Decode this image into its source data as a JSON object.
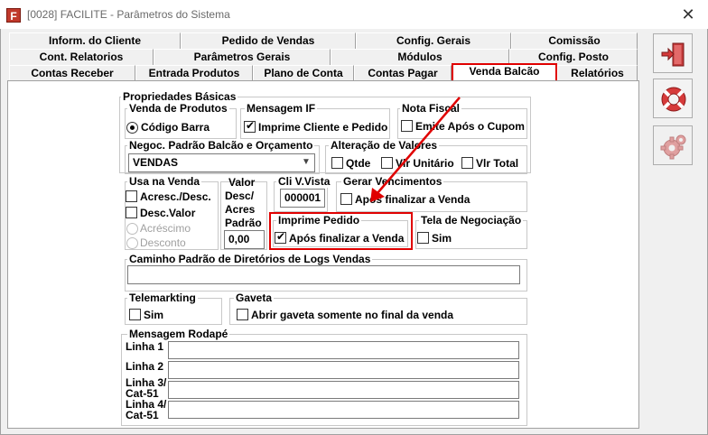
{
  "window": {
    "title": "[0028] FACILITE - Parâmetros do Sistema",
    "app_icon_letter": "F",
    "close_glyph": "✕"
  },
  "tabs": {
    "row1": [
      "Inform. do Cliente",
      "Pedido de Vendas",
      "Config. Gerais",
      "Comissão"
    ],
    "row2": [
      "Cont. Relatorios",
      "Parâmetros Gerais",
      "Módulos",
      "Config. Posto"
    ],
    "row3": [
      "Contas Receber",
      "Entrada Produtos",
      "Plano de Conta",
      "Contas Pagar",
      "Venda Balcão",
      "Relatórios"
    ],
    "active": "Venda Balcão"
  },
  "panel": {
    "propriedades_basicas": "Propriedades Básicas",
    "venda_de_produtos": {
      "title": "Venda de Produtos",
      "option": "Código Barra",
      "selected": true
    },
    "mensagem_if": {
      "title": "Mensagem IF",
      "option": "Imprime Cliente e Pedido",
      "checked": true
    },
    "nota_fiscal": {
      "title": "Nota Fiscal",
      "option": "Emite Após o Cupom",
      "checked": false
    },
    "negoc": {
      "title": "Negoc. Padrão Balcão e Orçamento",
      "value": "VENDAS"
    },
    "alteracao": {
      "title": "Alteração de Valores",
      "options": [
        "Qtde",
        "Vlr Unitário",
        "Vlr Total"
      ]
    },
    "usa_na_venda": {
      "title": "Usa na Venda",
      "options": [
        "Acresc./Desc.",
        "Desc.Valor"
      ],
      "radios": [
        "Acréscimo",
        "Desconto"
      ]
    },
    "valor": {
      "lines": [
        "Valor",
        "Desc/",
        "Acres",
        "Padrão"
      ],
      "value": "0,00"
    },
    "cli_vista": {
      "label": "Cli V.Vista",
      "value": "000001"
    },
    "gerar_vencimentos": {
      "title": "Gerar Vencimentos",
      "option": "Após finalizar a Venda",
      "checked": false
    },
    "imprime_pedido": {
      "title": "Imprime Pedido",
      "option": "Após finalizar a Venda",
      "checked": true
    },
    "tela_negociacao": {
      "title": "Tela de Negociação",
      "option": "Sim",
      "checked": false
    },
    "caminho": {
      "title": "Caminho Padrão de Diretórios de Logs Vendas",
      "value": ""
    },
    "telemarkting": {
      "title": "Telemarkting",
      "option": "Sim",
      "checked": false
    },
    "gaveta": {
      "title": "Gaveta",
      "option": "Abrir gaveta somente no final da venda",
      "checked": false
    },
    "rodape": {
      "title": "Mensagem Rodapé",
      "lines": [
        "Linha 1",
        "Linha 2",
        "Linha 3/ Cat-51",
        "Linha 4/ Cat-51"
      ]
    }
  },
  "side_buttons": [
    "exit-door-icon",
    "lifebuoy-icon",
    "gear-icon"
  ],
  "colors": {
    "highlight": "#e00000",
    "arrow": "#e00000",
    "exit_red": "#d63a3a"
  }
}
